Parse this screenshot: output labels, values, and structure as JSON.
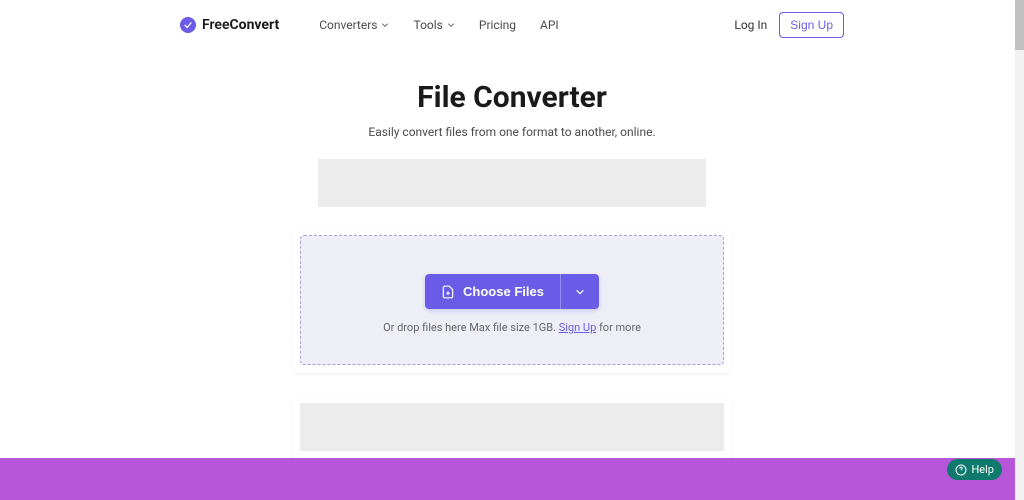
{
  "header": {
    "logo": {
      "free": "Free",
      "convert": "Convert"
    },
    "nav": {
      "converters": "Converters",
      "tools": "Tools",
      "pricing": "Pricing",
      "api": "API"
    },
    "login": "Log In",
    "signup": "Sign Up"
  },
  "main": {
    "title": "File Converter",
    "subtitle": "Easily convert files from one format to another, online."
  },
  "dropzone": {
    "choose": "Choose Files",
    "pre_text": "Or drop files here Max file size 1GB. ",
    "sign_up": "Sign Up",
    "post_text": " for more"
  },
  "help": {
    "label": "Help"
  }
}
